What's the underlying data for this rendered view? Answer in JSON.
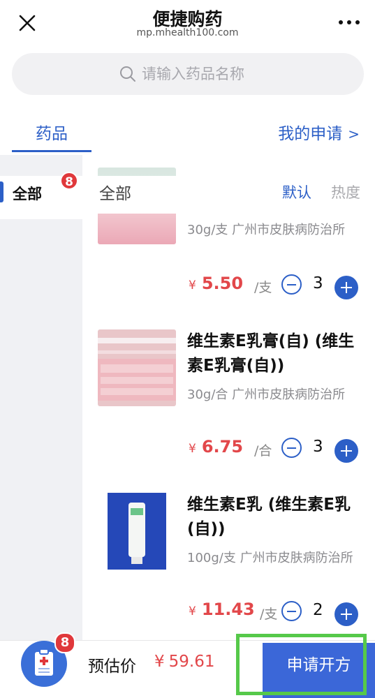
{
  "header": {
    "title": "便捷购药",
    "url": "mp.mhealth100.com"
  },
  "search": {
    "placeholder": "请输入药品名称",
    "value": ""
  },
  "tabs": {
    "drugs_label": "药品",
    "my_apply_label": "我的申请"
  },
  "sidebar": {
    "items": [
      {
        "label": "全部",
        "badge": "8"
      }
    ]
  },
  "list": {
    "title": "全部",
    "sort_default": "默认",
    "sort_hot": "热度"
  },
  "products": [
    {
      "name": "",
      "spec": "30g/支 广州市皮肤病防治所",
      "currency": "¥",
      "price": "5.50",
      "unit": "/支",
      "qty": "3"
    },
    {
      "name": "维生素E乳膏(自) (维生素E乳膏(自))",
      "spec": "30g/合 广州市皮肤病防治所",
      "currency": "¥",
      "price": "6.75",
      "unit": "/合",
      "qty": "3"
    },
    {
      "name": "维生素E乳 (维生素E乳(自))",
      "spec": "100g/支 广州市皮肤病防治所",
      "currency": "¥",
      "price": "11.43",
      "unit": "/支",
      "qty": "2"
    }
  ],
  "cart": {
    "badge": "8",
    "estimate_label": "预估价",
    "currency": "¥",
    "estimate_value": "59.61",
    "submit_label": "申请开方"
  },
  "colors": {
    "accent": "#2c5fc7",
    "price": "#e2474a",
    "badge": "#e0383b",
    "highlight": "#56c94a"
  },
  "icons": [
    "close-icon",
    "more-icon",
    "search-icon",
    "chevron-right-icon",
    "minus-icon",
    "plus-icon",
    "prescription-clipboard-icon"
  ]
}
